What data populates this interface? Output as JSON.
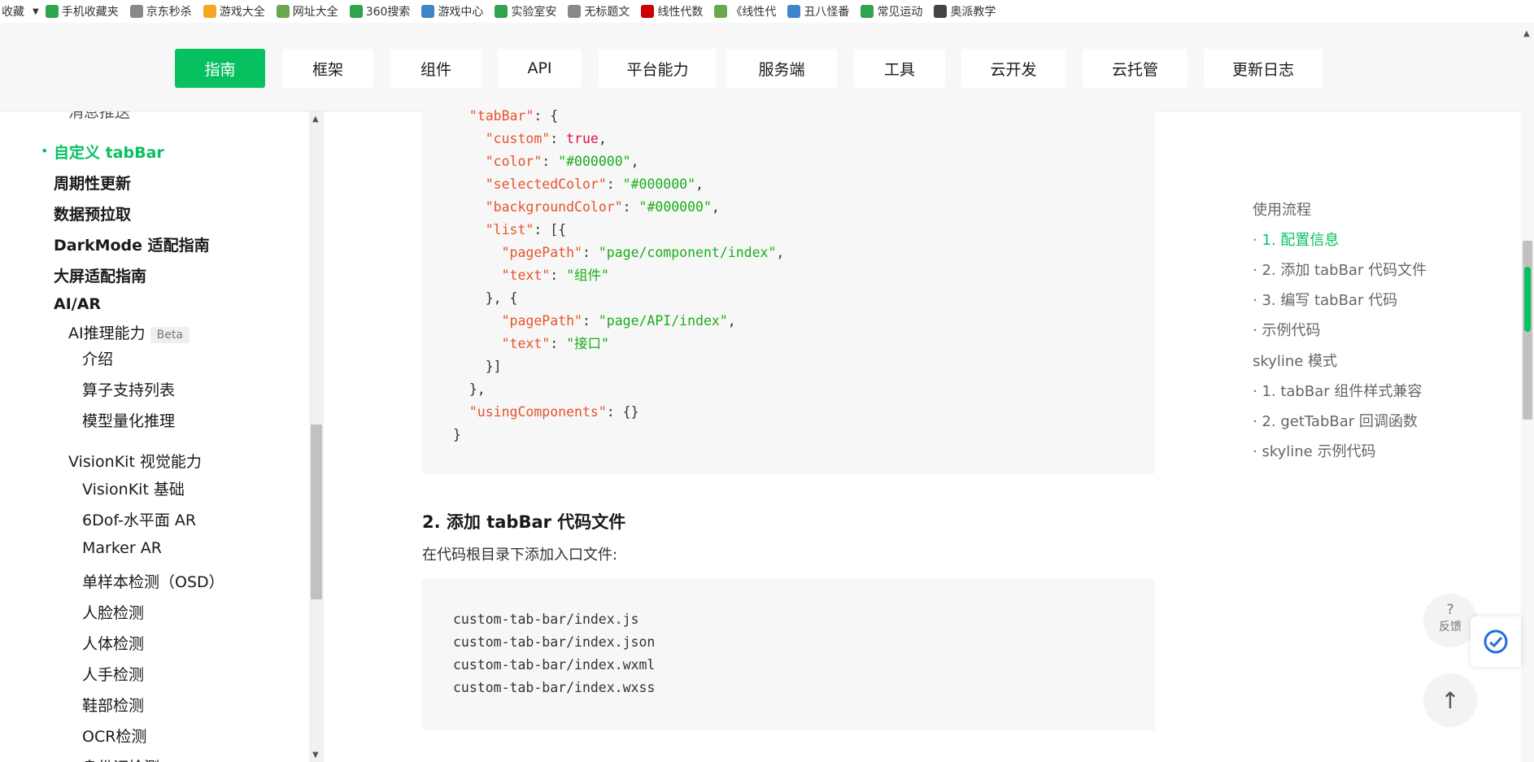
{
  "bookmarks": {
    "favorites_label": "收藏",
    "items": [
      {
        "label": "手机收藏夹",
        "color": "#2ea44f"
      },
      {
        "label": "京东秒杀",
        "color": "#888888"
      },
      {
        "label": "游戏大全",
        "color": "#f5a623"
      },
      {
        "label": "网址大全",
        "color": "#6aa84f"
      },
      {
        "label": "360搜索",
        "color": "#2ea44f"
      },
      {
        "label": "游戏中心",
        "color": "#3d85c6"
      },
      {
        "label": "实验室安",
        "color": "#2ea44f"
      },
      {
        "label": "无标题文",
        "color": "#888888"
      },
      {
        "label": "线性代数",
        "color": "#cc0000"
      },
      {
        "label": "《线性代",
        "color": "#6aa84f"
      },
      {
        "label": "丑八怪番",
        "color": "#3d85c6"
      },
      {
        "label": "常见运动",
        "color": "#2ea44f"
      },
      {
        "label": "奥派教学",
        "color": "#444444"
      }
    ]
  },
  "topnav": {
    "tabs": [
      "指南",
      "框架",
      "组件",
      "API",
      "平台能力",
      "服务端",
      "工具",
      "云开发",
      "云托管",
      "更新日志"
    ],
    "active": "指南"
  },
  "sidebar": {
    "partial_top": "消息推送",
    "active_item": "自定义 tabBar",
    "items": [
      "周期性更新",
      "数据预拉取",
      "DarkMode 适配指南",
      "大屏适配指南",
      "AI/AR"
    ],
    "ai_infer": "AI推理能力",
    "beta": "Beta",
    "ai_infer_children": [
      "介绍",
      "算子支持列表",
      "模型量化推理"
    ],
    "visionkit": "VisionKit 视觉能力",
    "visionkit_children": [
      "VisionKit 基础",
      "6Dof-水平面 AR",
      "Marker AR",
      "单样本检测（OSD）",
      "人脸检测",
      "人体检测",
      "人手检测",
      "鞋部检测",
      "OCR检测",
      "身份证检测"
    ]
  },
  "code1": {
    "lines": [
      [
        "  ",
        [
          "k",
          "\"tabBar\""
        ],
        [
          "p",
          ": {"
        ]
      ],
      [
        "    ",
        [
          "k",
          "\"custom\""
        ],
        [
          "p",
          ": "
        ],
        [
          "v",
          "true"
        ],
        [
          "p",
          ","
        ]
      ],
      [
        "    ",
        [
          "k",
          "\"color\""
        ],
        [
          "p",
          ": "
        ],
        [
          "s",
          "\"#000000\""
        ],
        [
          "p",
          ","
        ]
      ],
      [
        "    ",
        [
          "k",
          "\"selectedColor\""
        ],
        [
          "p",
          ": "
        ],
        [
          "s",
          "\"#000000\""
        ],
        [
          "p",
          ","
        ]
      ],
      [
        "    ",
        [
          "k",
          "\"backgroundColor\""
        ],
        [
          "p",
          ": "
        ],
        [
          "s",
          "\"#000000\""
        ],
        [
          "p",
          ","
        ]
      ],
      [
        "    ",
        [
          "k",
          "\"list\""
        ],
        [
          "p",
          ": [{"
        ]
      ],
      [
        "      ",
        [
          "k",
          "\"pagePath\""
        ],
        [
          "p",
          ": "
        ],
        [
          "s",
          "\"page/component/index\""
        ],
        [
          "p",
          ","
        ]
      ],
      [
        "      ",
        [
          "k",
          "\"text\""
        ],
        [
          "p",
          ": "
        ],
        [
          "s",
          "\"组件\""
        ]
      ],
      [
        "    ",
        [
          "p",
          "}, {"
        ]
      ],
      [
        "      ",
        [
          "k",
          "\"pagePath\""
        ],
        [
          "p",
          ": "
        ],
        [
          "s",
          "\"page/API/index\""
        ],
        [
          "p",
          ","
        ]
      ],
      [
        "      ",
        [
          "k",
          "\"text\""
        ],
        [
          "p",
          ": "
        ],
        [
          "s",
          "\"接口\""
        ]
      ],
      [
        "    ",
        [
          "p",
          "}]"
        ]
      ],
      [
        "  ",
        [
          "p",
          "},"
        ]
      ],
      [
        "  ",
        [
          "k",
          "\"usingComponents\""
        ],
        [
          "p",
          ": {}"
        ]
      ],
      [
        "",
        [
          "p",
          "}"
        ]
      ]
    ]
  },
  "section": {
    "heading": "2. 添加 tabBar 代码文件",
    "paragraph": "在代码根目录下添加入口文件:"
  },
  "code2": {
    "lines": [
      "custom-tab-bar/index.js",
      "custom-tab-bar/index.json",
      "custom-tab-bar/index.wxml",
      "custom-tab-bar/index.wxss"
    ]
  },
  "toc": {
    "items": [
      {
        "label": "使用流程",
        "active": false
      },
      {
        "label": "· 1. 配置信息",
        "active": true
      },
      {
        "label": "· 2. 添加 tabBar 代码文件",
        "active": false
      },
      {
        "label": "· 3. 编写 tabBar 代码",
        "active": false
      },
      {
        "label": "· 示例代码",
        "active": false
      },
      {
        "label": "skyline 模式",
        "active": false
      },
      {
        "label": "· 1. tabBar 组件样式兼容",
        "active": false
      },
      {
        "label": "· 2. getTabBar 回调函数",
        "active": false
      },
      {
        "label": "· skyline 示例代码",
        "active": false
      }
    ]
  },
  "floating": {
    "feedback_icon": "?",
    "feedback_label": "反馈",
    "totop_icon": "↑"
  },
  "colors": {
    "accent": "#07c160"
  }
}
